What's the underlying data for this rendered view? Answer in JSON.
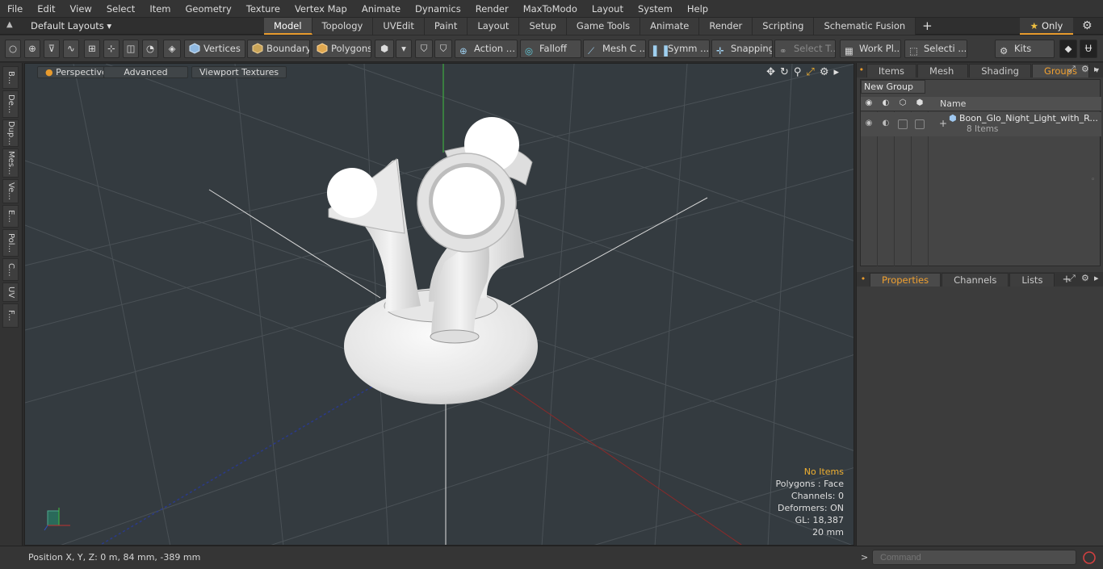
{
  "menu": [
    "File",
    "Edit",
    "View",
    "Select",
    "Item",
    "Geometry",
    "Texture",
    "Vertex Map",
    "Animate",
    "Dynamics",
    "Render",
    "MaxToModo",
    "Layout",
    "System",
    "Help"
  ],
  "layout_selector": "Default Layouts",
  "layout_tabs": [
    "Model",
    "Topology",
    "UVEdit",
    "Paint",
    "Layout",
    "Setup",
    "Game Tools",
    "Animate",
    "Render",
    "Scripting",
    "Schematic Fusion"
  ],
  "active_tab": "Model",
  "only_button": "Only",
  "toolbar": {
    "vertices": "Vertices",
    "boundary": "Boundary",
    "polygons": "Polygons",
    "action": "Action",
    "falloff": "Falloff",
    "mesh_c": "Mesh C ...",
    "symm": "Symm ...",
    "snapping": "Snapping",
    "select_t": "Select T...",
    "work_pl": "Work Pl...",
    "selecti": "Selecti ...",
    "kits": "Kits"
  },
  "left_strip": [
    "B...",
    "De...",
    "Dup...",
    "Mes...",
    "Ve...",
    "E...",
    "Pol...",
    "C...",
    "UV",
    "F..."
  ],
  "viewport": {
    "perspective": "Perspective",
    "advanced": "Advanced",
    "viewport_textures": "Viewport Textures",
    "info": {
      "no_items": "No Items",
      "polygons": "Polygons : Face",
      "channels": "Channels: 0",
      "deformers": "Deformers: ON",
      "gl": "GL: 18,387",
      "scale": "20 mm"
    }
  },
  "right_panel": {
    "tabs": [
      "Items",
      "Mesh ...",
      "Shading",
      "Groups"
    ],
    "active_tab": "Groups",
    "new_group": "New Group",
    "name_header": "Name",
    "group_name": "Boon_Glo_Night_Light_with_R...",
    "group_count": "8 Items",
    "lower_tabs": [
      "Properties",
      "Channels",
      "Lists"
    ],
    "lower_active": "Properties"
  },
  "status": {
    "position": "Position X, Y, Z:   0 m, 84 mm, -389 mm",
    "prompt": ">",
    "command_placeholder": "Command"
  },
  "colors": {
    "accent": "#e89b2d",
    "viewport_bg": "#343b40",
    "warning_text": "#f0b030"
  }
}
